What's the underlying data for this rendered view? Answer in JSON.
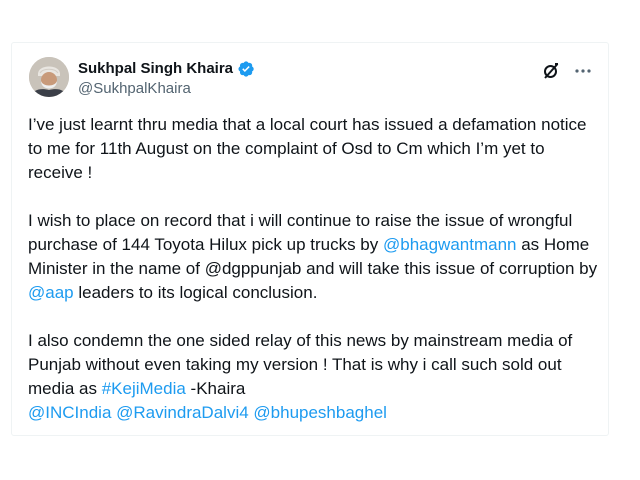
{
  "author": {
    "display_name": "Sukhpal Singh Khaira",
    "handle": "@SukhpalKhaira",
    "verified_color": "#1d9bf0"
  },
  "icons": {
    "grok": "grok-icon",
    "more": "more-options-icon",
    "verified": "verified-badge-icon"
  },
  "tweet": {
    "p1": "I’ve just learnt thru media that a local court has issued a defamation notice to me for 11th August on the complaint of Osd to Cm which I’m yet to receive !",
    "p2_a": "I wish to place on record that i will continue to raise the issue of wrongful purchase of 144 Toyota Hilux pick up trucks by ",
    "p2_mention1": "@bhagwantmann",
    "p2_b": " as Home Minister in the name of @dgppunjab and will take this issue of corruption by ",
    "p2_mention2": "@aap",
    "p2_c": " leaders to its logical conclusion.",
    "p3_a": "I also condemn the one sided relay of this news by mainstream media of Punjab without even taking my version ! That is why i call such sold out media as ",
    "p3_hashtag": "#KejiMedia",
    "p3_b": " -Khaira",
    "mention_inc": "@INCIndia",
    "mention_dalvi": "@RavindraDalvi4",
    "mention_baghel": "@bhupeshbaghel"
  },
  "colors": {
    "link": "#1d9bf0",
    "text": "#0f1419",
    "secondary": "#536471"
  }
}
